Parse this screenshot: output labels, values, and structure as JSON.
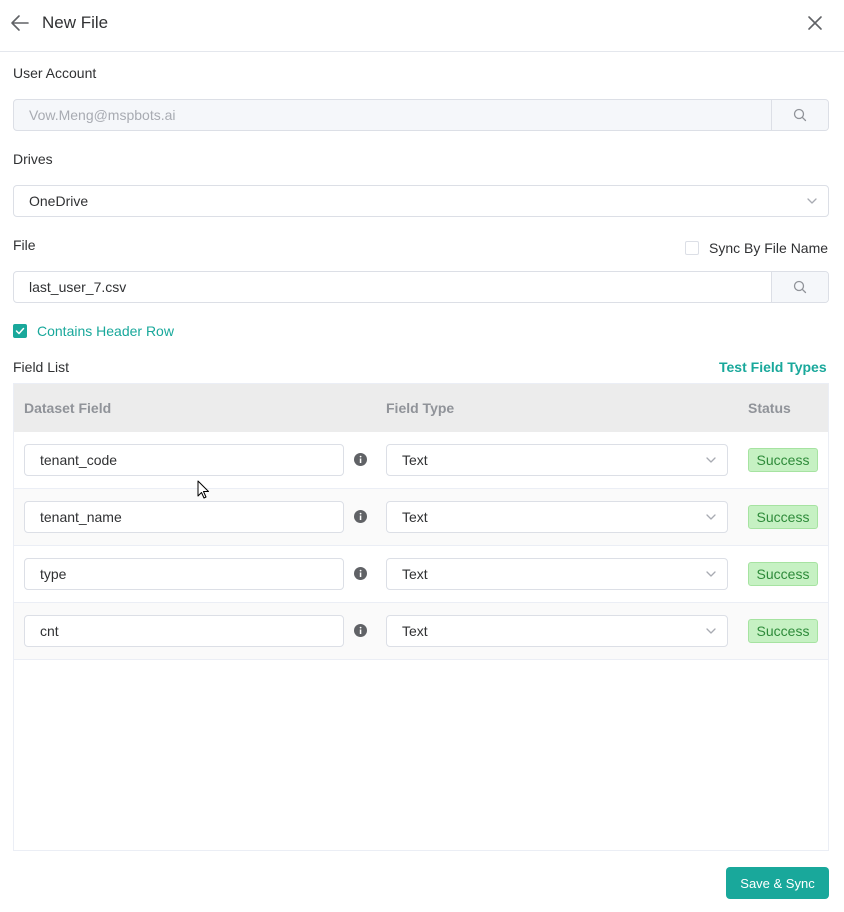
{
  "header": {
    "title": "New File"
  },
  "user_account": {
    "label": "User Account",
    "value": "Vow.Meng@mspbots.ai"
  },
  "drives": {
    "label": "Drives",
    "selected": "OneDrive"
  },
  "file": {
    "label": "File",
    "value": "last_user_7.csv",
    "sync_by_name_label": "Sync By File Name",
    "sync_by_name_checked": false
  },
  "contains_header": {
    "label": "Contains Header Row",
    "checked": true
  },
  "field_list": {
    "label": "Field List",
    "test_link": "Test Field Types",
    "columns": [
      "Dataset Field",
      "Field Type",
      "Status"
    ],
    "rows": [
      {
        "field": "tenant_code",
        "type": "Text",
        "status": "Success"
      },
      {
        "field": "tenant_name",
        "type": "Text",
        "status": "Success"
      },
      {
        "field": "type",
        "type": "Text",
        "status": "Success"
      },
      {
        "field": "cnt",
        "type": "Text",
        "status": "Success"
      }
    ]
  },
  "footer": {
    "save_label": "Save & Sync"
  },
  "colors": {
    "accent": "#19a89b",
    "success_bg": "#c6f1c3",
    "success_text": "#2e8b3a"
  }
}
